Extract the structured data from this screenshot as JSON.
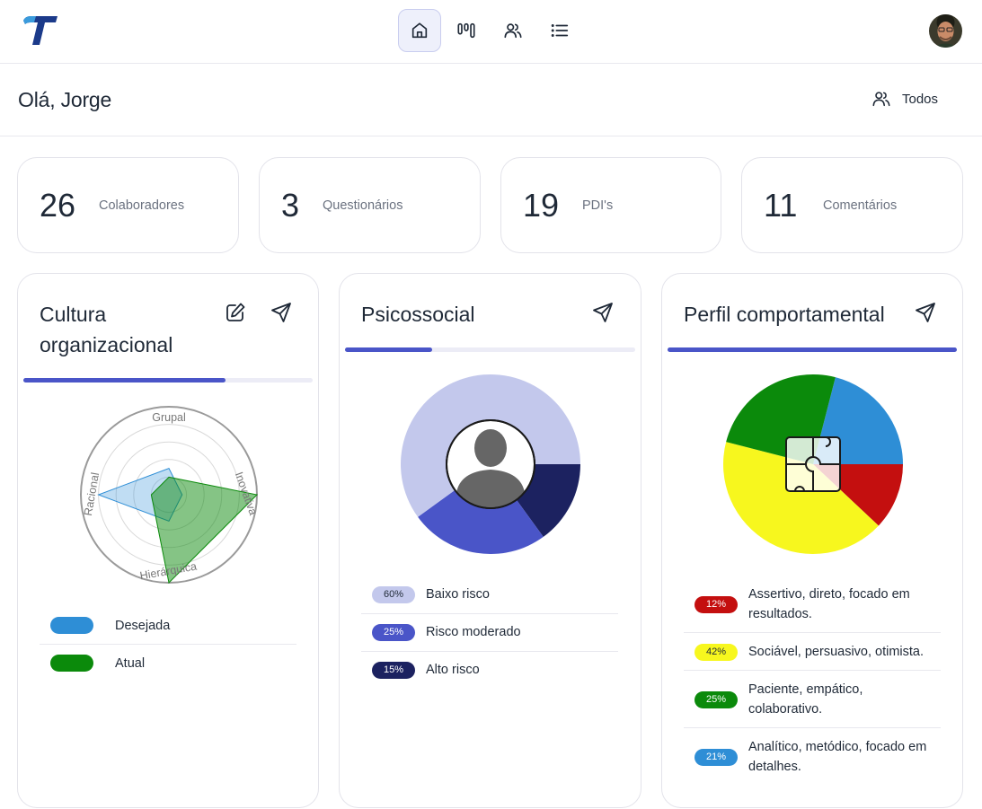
{
  "header": {
    "avatar_alt": "user avatar"
  },
  "greeting": {
    "text": "Olá, Jorge",
    "filter_label": "Todos"
  },
  "stats": [
    {
      "value": "26",
      "label": "Colaboradores"
    },
    {
      "value": "3",
      "label": "Questionários"
    },
    {
      "value": "19",
      "label": "PDI's"
    },
    {
      "value": "11",
      "label": "Comentários"
    }
  ],
  "cultura": {
    "title_line1": "Cultura",
    "title_line2": "organizacional",
    "progress": 0.7,
    "radar_axes": [
      "Grupal",
      "Inovativa",
      "Hierárquica",
      "Racional"
    ],
    "legend": [
      {
        "label": "Desejada",
        "color": "#2e8ed6"
      },
      {
        "label": "Atual",
        "color": "#0b8a0b"
      }
    ]
  },
  "psicossocial": {
    "title": "Psicossocial",
    "progress": 0.3,
    "items": [
      {
        "pct": "60%",
        "label": "Baixo risco",
        "color": "#c3c8ec",
        "text_color": "#1f2937"
      },
      {
        "pct": "25%",
        "label": "Risco moderado",
        "color": "#4a55c8",
        "text_color": "#ffffff"
      },
      {
        "pct": "15%",
        "label": "Alto risco",
        "color": "#1c2260",
        "text_color": "#ffffff"
      }
    ]
  },
  "perfil": {
    "title": "Perfil comportamental",
    "progress": 1.0,
    "items": [
      {
        "pct": "12%",
        "line1": "Assertivo, direto, focado em",
        "line2": "resultados.",
        "color": "#c40f0f",
        "text_color": "#ffffff"
      },
      {
        "pct": "42%",
        "line1": "Sociável, persuasivo, otimista.",
        "line2": "",
        "color": "#f7f71e",
        "text_color": "#1f2937"
      },
      {
        "pct": "25%",
        "line1": "Paciente, empático,",
        "line2": "colaborativo.",
        "color": "#0b8a0b",
        "text_color": "#ffffff"
      },
      {
        "pct": "21%",
        "line1": "Analítico, metódico, focado em",
        "line2": "detalhes.",
        "color": "#2e8ed6",
        "text_color": "#ffffff"
      }
    ]
  },
  "chart_data": [
    {
      "type": "radar",
      "axes": [
        "Grupal",
        "Inovativa",
        "Hierárquica",
        "Racional"
      ],
      "series": [
        {
          "name": "Desejada",
          "values": [
            0.3,
            0.15,
            0.3,
            0.8
          ]
        },
        {
          "name": "Atual",
          "values": [
            0.2,
            1.0,
            1.0,
            0.2
          ]
        }
      ]
    },
    {
      "type": "pie",
      "categories": [
        "Baixo risco",
        "Risco moderado",
        "Alto risco"
      ],
      "values": [
        60,
        25,
        15
      ]
    },
    {
      "type": "pie",
      "categories": [
        "Assertivo, direto, focado em resultados.",
        "Sociável, persuasivo, otimista.",
        "Paciente, empático, colaborativo.",
        "Analítico, metódico, focado em detalhes."
      ],
      "values": [
        12,
        42,
        25,
        21
      ]
    }
  ]
}
